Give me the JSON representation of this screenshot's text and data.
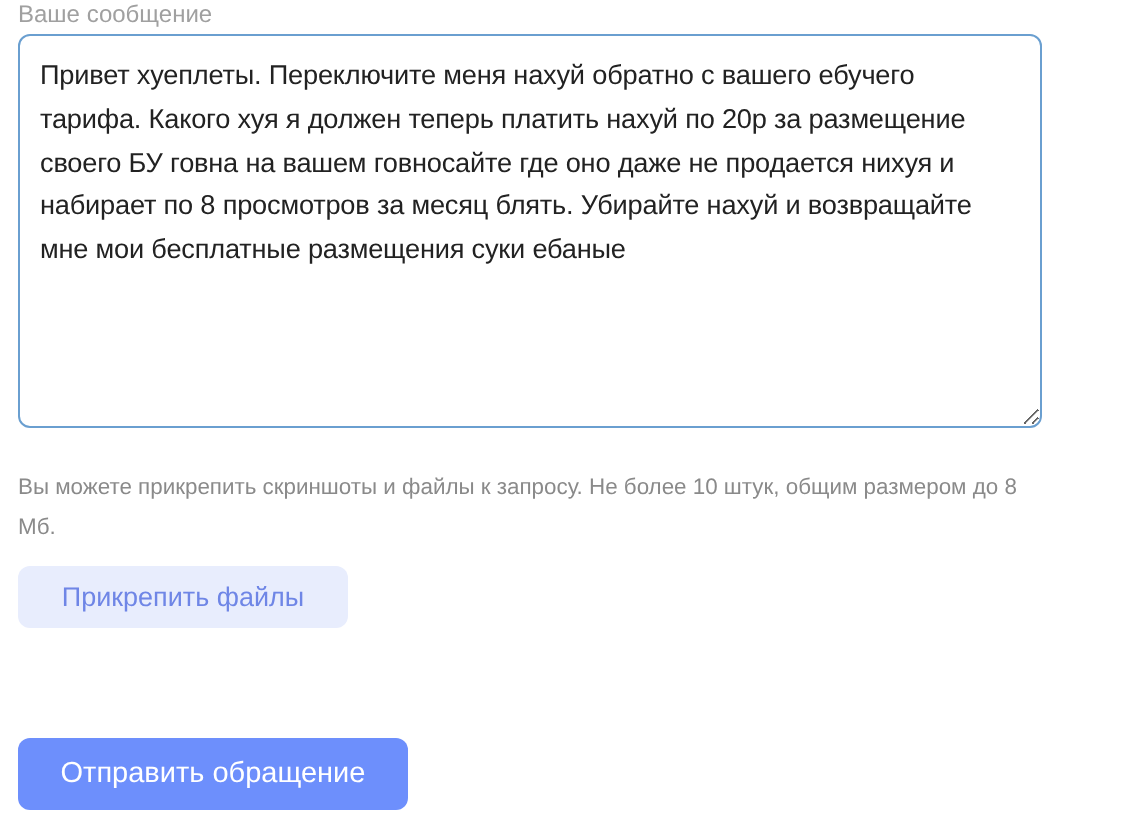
{
  "message_field": {
    "label": "Ваше сообщение",
    "value": "Привет хуеплеты. Переключите меня нахуй обратно с вашего ебучего тарифа. Какого хуя я должен теперь платить нахуй по 20р за размещение своего БУ говна на вашем говносайте где оно даже не продается нихуя и набирает по 8 просмотров за месяц блять. Убирайте нахуй и возвращайте мне мои бесплатные размещения суки ебаные"
  },
  "attachments": {
    "hint": "Вы можете прикрепить скриншоты и файлы к запросу. Не более 10 штук, общим размером до 8 Мб.",
    "button": "Прикрепить файлы"
  },
  "submit_button": "Отправить обращение"
}
